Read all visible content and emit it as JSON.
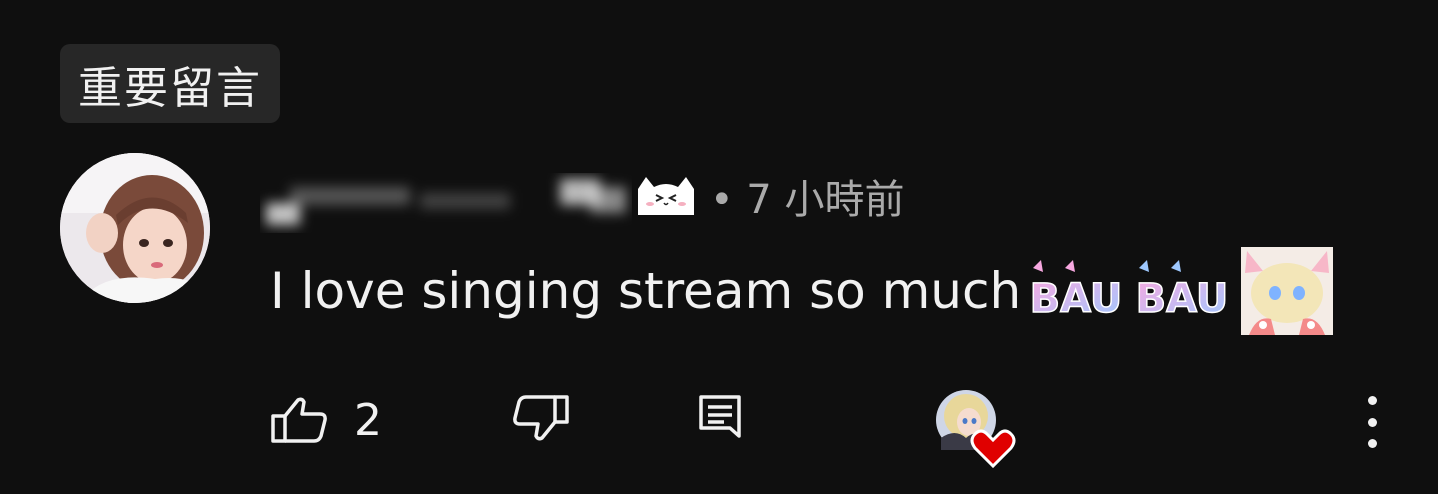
{
  "pinned": {
    "label": "重要留言"
  },
  "comment": {
    "time_label": "• 7 小時前",
    "text": "I love singing stream so much",
    "emotes": [
      "BAU",
      "BAU",
      "character-emote"
    ],
    "like_count": "2"
  },
  "icons": {
    "like": "thumbs-up-icon",
    "dislike": "thumbs-down-icon",
    "reply": "reply-comment-icon",
    "more": "more-vert-icon",
    "heart": "creator-heart-icon"
  },
  "colors": {
    "background": "#0f0f0f",
    "chip": "#272727",
    "text": "#f1f1f1",
    "muted": "#aaaaaa",
    "heart": "#e00000",
    "bau_pink": "#f7a8e0",
    "bau_blue": "#9ec8ff"
  }
}
